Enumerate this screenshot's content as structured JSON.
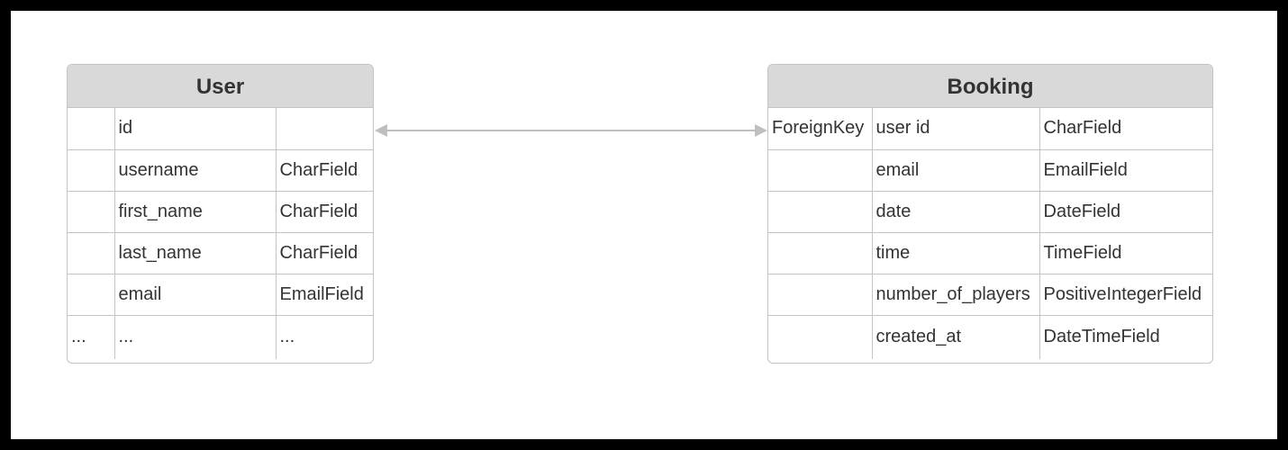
{
  "entities": [
    {
      "title": "User",
      "rows": [
        [
          "",
          "id",
          ""
        ],
        [
          "",
          "username",
          "CharField"
        ],
        [
          "",
          "first_name",
          "CharField"
        ],
        [
          "",
          "last_name",
          "CharField"
        ],
        [
          "",
          "email",
          "EmailField"
        ],
        [
          "...",
          "...",
          "..."
        ]
      ]
    },
    {
      "title": "Booking",
      "rows": [
        [
          "ForeignKey",
          "user id",
          "CharField"
        ],
        [
          "",
          "email",
          "EmailField"
        ],
        [
          "",
          "date",
          "DateField"
        ],
        [
          "",
          "time",
          "TimeField"
        ],
        [
          "",
          "number_of_players",
          "PositiveIntegerField"
        ],
        [
          "",
          "created_at",
          "DateTimeField"
        ]
      ]
    }
  ],
  "colors": {
    "header_bg": "#d9d9d9",
    "border": "#c4c4c4",
    "text": "#333333",
    "connector": "#bfbfbf"
  }
}
